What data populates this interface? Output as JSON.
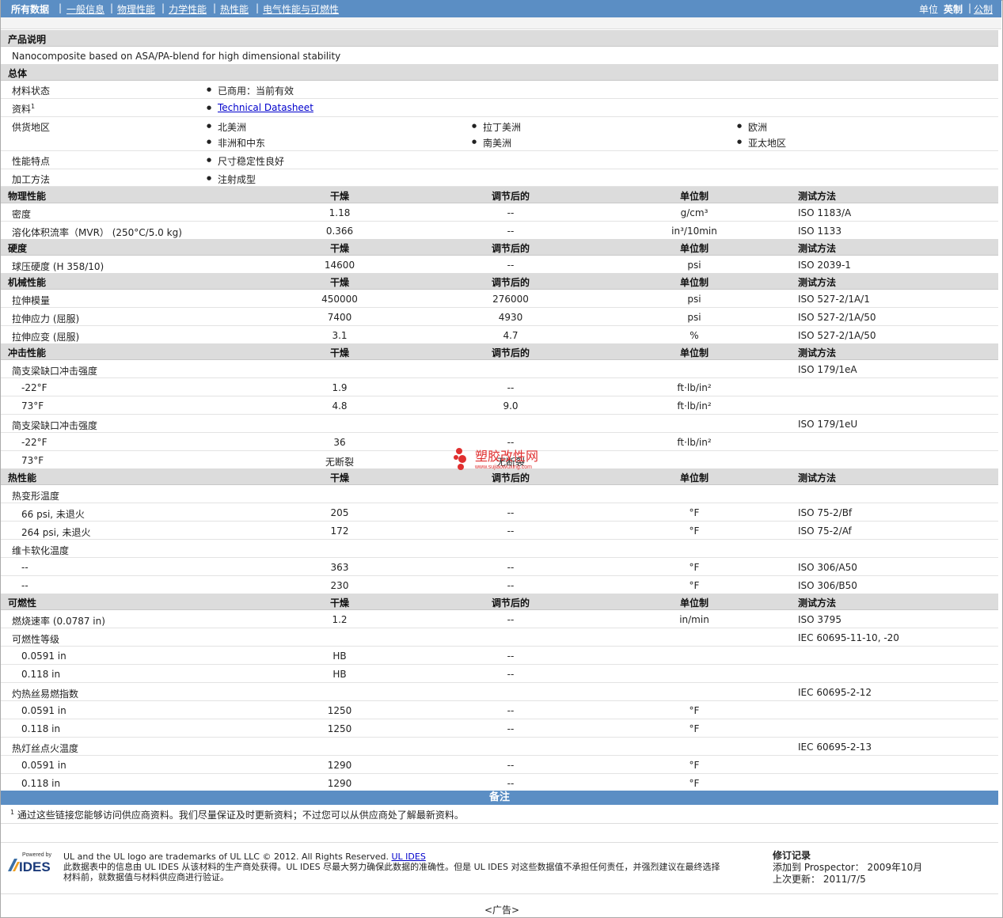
{
  "nav": {
    "tabs": [
      "所有数据",
      "一般信息",
      "物理性能",
      "力学性能",
      "热性能",
      "电气性能与可燃性"
    ],
    "unit_label": "单位",
    "unit_english": "英制",
    "unit_metric": "公制"
  },
  "product": {
    "title": "产品说明",
    "description": "Nanocomposite based on ASA/PA-blend for high dimensional stability"
  },
  "general": {
    "title": "总体",
    "status_label": "材料状态",
    "status_value": "已商用：当前有效",
    "source_label": "资料",
    "source_sup": "1",
    "source_value": "Technical Datasheet",
    "region_label": "供货地区",
    "regions": [
      "北美洲",
      "拉丁美洲",
      "欧洲",
      "非洲和中东",
      "南美洲",
      "亚太地区"
    ],
    "feature_label": "性能特点",
    "feature_value": "尺寸稳定性良好",
    "process_label": "加工方法",
    "process_value": "注射成型"
  },
  "cols": {
    "dry": "干燥",
    "cond": "调节后的",
    "unit": "单位制",
    "method": "测试方法"
  },
  "physical": {
    "title": "物理性能",
    "rows": [
      {
        "name": "密度",
        "dry": "1.18",
        "cond": "--",
        "unit": "g/cm³",
        "method": "ISO 1183/A"
      },
      {
        "name": "溶化体积流率（MVR） (250°C/5.0 kg)",
        "dry": "0.366",
        "cond": "--",
        "unit": "in³/10min",
        "method": "ISO 1133"
      }
    ]
  },
  "hardness": {
    "title": "硬度",
    "rows": [
      {
        "name": "球压硬度 (H 358/10)",
        "dry": "14600",
        "cond": "--",
        "unit": "psi",
        "method": "ISO 2039-1"
      }
    ]
  },
  "mechanical": {
    "title": "机械性能",
    "rows": [
      {
        "name": "拉伸模量",
        "dry": "450000",
        "cond": "276000",
        "unit": "psi",
        "method": "ISO 527-2/1A/1"
      },
      {
        "name": "拉伸应力 (屈服)",
        "dry": "7400",
        "cond": "4930",
        "unit": "psi",
        "method": "ISO 527-2/1A/50"
      },
      {
        "name": "拉伸应变 (屈服)",
        "dry": "3.1",
        "cond": "4.7",
        "unit": "%",
        "method": "ISO 527-2/1A/50"
      }
    ]
  },
  "impact": {
    "title": "冲击性能",
    "rows": [
      {
        "name": "简支梁缺口冲击强度",
        "dry": "",
        "cond": "",
        "unit": "",
        "method": "ISO 179/1eA",
        "sub": false
      },
      {
        "name": "-22°F",
        "dry": "1.9",
        "cond": "--",
        "unit": "ft·lb/in²",
        "method": "",
        "sub": true
      },
      {
        "name": "73°F",
        "dry": "4.8",
        "cond": "9.0",
        "unit": "ft·lb/in²",
        "method": "",
        "sub": true
      },
      {
        "name": "简支梁缺口冲击强度",
        "dry": "",
        "cond": "",
        "unit": "",
        "method": "ISO 179/1eU",
        "sub": false
      },
      {
        "name": "-22°F",
        "dry": "36",
        "cond": "--",
        "unit": "ft·lb/in²",
        "method": "",
        "sub": true
      },
      {
        "name": "73°F",
        "dry": "无断裂",
        "cond": "无断裂",
        "unit": "",
        "method": "",
        "sub": true
      }
    ]
  },
  "thermal": {
    "title": "热性能",
    "rows": [
      {
        "name": "热变形温度",
        "dry": "",
        "cond": "",
        "unit": "",
        "method": "",
        "sub": false
      },
      {
        "name": "66 psi, 未退火",
        "dry": "205",
        "cond": "--",
        "unit": "°F",
        "method": "ISO 75-2/Bf",
        "sub": true
      },
      {
        "name": "264 psi, 未退火",
        "dry": "172",
        "cond": "--",
        "unit": "°F",
        "method": "ISO 75-2/Af",
        "sub": true
      },
      {
        "name": "维卡软化温度",
        "dry": "",
        "cond": "",
        "unit": "",
        "method": "",
        "sub": false
      },
      {
        "name": "--",
        "dry": "363",
        "cond": "--",
        "unit": "°F",
        "method": "ISO 306/A50",
        "sub": true
      },
      {
        "name": "--",
        "dry": "230",
        "cond": "--",
        "unit": "°F",
        "method": "ISO 306/B50",
        "sub": true
      }
    ]
  },
  "flammability": {
    "title": "可燃性",
    "rows": [
      {
        "name": "燃烧速率 (0.0787 in)",
        "dry": "1.2",
        "cond": "--",
        "unit": "in/min",
        "method": "ISO 3795",
        "sub": false
      },
      {
        "name": "可燃性等级",
        "dry": "",
        "cond": "",
        "unit": "",
        "method": "IEC 60695-11-10, -20",
        "sub": false
      },
      {
        "name": "0.0591 in",
        "dry": "HB",
        "cond": "--",
        "unit": "",
        "method": "",
        "sub": true
      },
      {
        "name": "0.118 in",
        "dry": "HB",
        "cond": "--",
        "unit": "",
        "method": "",
        "sub": true
      },
      {
        "name": "灼热丝易燃指数",
        "dry": "",
        "cond": "",
        "unit": "",
        "method": "IEC 60695-2-12",
        "sub": false
      },
      {
        "name": "0.0591 in",
        "dry": "1250",
        "cond": "--",
        "unit": "°F",
        "method": "",
        "sub": true
      },
      {
        "name": "0.118 in",
        "dry": "1250",
        "cond": "--",
        "unit": "°F",
        "method": "",
        "sub": true
      },
      {
        "name": "热灯丝点火温度",
        "dry": "",
        "cond": "",
        "unit": "",
        "method": "IEC 60695-2-13",
        "sub": false
      },
      {
        "name": "0.0591 in",
        "dry": "1290",
        "cond": "--",
        "unit": "°F",
        "method": "",
        "sub": true
      },
      {
        "name": "0.118 in",
        "dry": "1290",
        "cond": "--",
        "unit": "°F",
        "method": "",
        "sub": true
      }
    ]
  },
  "notes": {
    "title": "备注",
    "sup": "1",
    "text": "通过这些链接您能够访问供应商资料。我们尽量保证及时更新资料；不过您可以从供应商处了解最新资料。"
  },
  "footer": {
    "logo_small": "Powered by",
    "logo_text": "IDES",
    "copyright": "UL and the UL logo are trademarks of UL LLC © 2012. All Rights Reserved.",
    "ul_link": "UL IDES",
    "disclaimer1": "此数据表中的信息由 UL IDES 从该材料的生产商处获得。UL IDES 尽最大努力确保此数据的准确性。但是 UL IDES 对这些数据值不承担任何责任，并强烈建议在最终选择",
    "disclaimer2": "材料前，就数据值与材料供应商进行验证。",
    "rev_title": "修订记录",
    "rev_added": "添加到 Prospector： 2009年10月",
    "rev_updated": "上次更新： 2011/7/5",
    "ad": "<广告>"
  },
  "watermark": {
    "text": "塑胶改性网",
    "url": "www.sujiaowuxing.com",
    "color": "#e03030"
  }
}
